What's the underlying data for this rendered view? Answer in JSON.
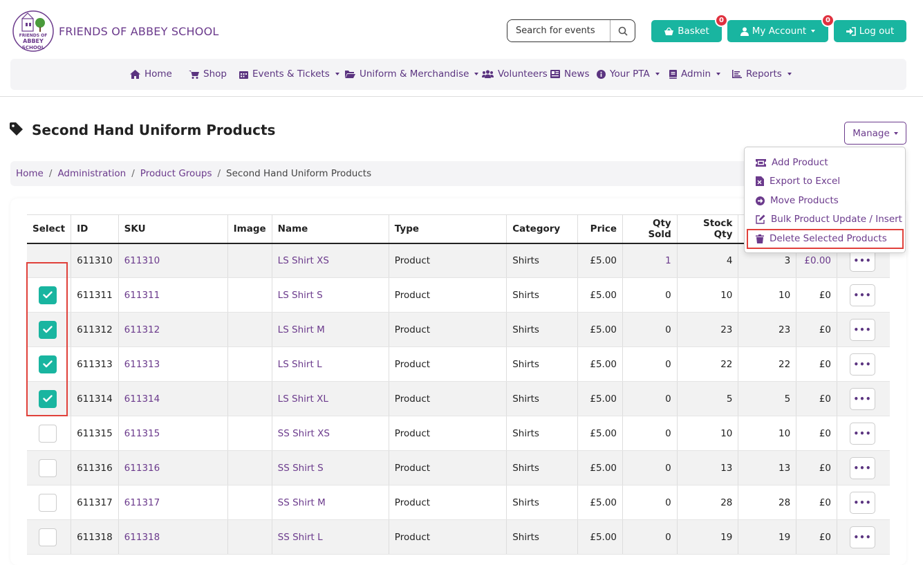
{
  "header": {
    "site_title": "FRIENDS OF ABBEY SCHOOL",
    "logo_text": "FRIENDS OF ABBEY SCHOOL",
    "search_placeholder": "Search for events",
    "basket_label": "Basket",
    "basket_count": "0",
    "account_label": "My Account",
    "account_count": "0",
    "logout_label": "Log out"
  },
  "nav": [
    {
      "label": "Home",
      "icon": "home-icon"
    },
    {
      "label": "Shop",
      "icon": "cart-icon"
    },
    {
      "label": "Events & Tickets",
      "icon": "calendar-icon"
    },
    {
      "label": "Uniform & Merchandise",
      "icon": "folder-icon"
    },
    {
      "label": "Volunteers",
      "icon": "users-icon"
    },
    {
      "label": "News",
      "icon": "newspaper-icon"
    },
    {
      "label": "Your PTA",
      "icon": "info-icon"
    },
    {
      "label": "Admin",
      "icon": "book-icon"
    },
    {
      "label": "Reports",
      "icon": "chart-icon"
    }
  ],
  "page": {
    "title": "Second Hand Uniform Products",
    "manage_label": "Manage"
  },
  "breadcrumb": [
    "Home",
    "Administration",
    "Product Groups",
    "Second Hand Uniform Products"
  ],
  "manage_menu": [
    {
      "label": "Add Product",
      "icon": "ticket-icon"
    },
    {
      "label": "Export to Excel",
      "icon": "excel-icon"
    },
    {
      "label": "Move Products",
      "icon": "arrow-circle-icon"
    },
    {
      "label": "Bulk Product Update / Insert",
      "icon": "edit-icon"
    },
    {
      "label": "Delete Selected Products",
      "icon": "trash-icon"
    }
  ],
  "table": {
    "columns": [
      "Select",
      "ID",
      "SKU",
      "Image",
      "Name",
      "Type",
      "Category",
      "Price",
      "Qty Sold",
      "Stock Qty",
      "",
      "",
      ""
    ],
    "rows": [
      {
        "selected": null,
        "id": "611310",
        "sku": "611310",
        "name": "LS Shirt XS",
        "type": "Product",
        "category": "Shirts",
        "price": "£5.00",
        "qty_sold": "1",
        "stock": "4",
        "avail": "3",
        "revenue": "£0.00"
      },
      {
        "selected": true,
        "id": "611311",
        "sku": "611311",
        "name": "LS Shirt S",
        "type": "Product",
        "category": "Shirts",
        "price": "£5.00",
        "qty_sold": "0",
        "stock": "10",
        "avail": "10",
        "revenue": "£0"
      },
      {
        "selected": true,
        "id": "611312",
        "sku": "611312",
        "name": "LS Shirt M",
        "type": "Product",
        "category": "Shirts",
        "price": "£5.00",
        "qty_sold": "0",
        "stock": "23",
        "avail": "23",
        "revenue": "£0"
      },
      {
        "selected": true,
        "id": "611313",
        "sku": "611313",
        "name": "LS Shirt L",
        "type": "Product",
        "category": "Shirts",
        "price": "£5.00",
        "qty_sold": "0",
        "stock": "22",
        "avail": "22",
        "revenue": "£0"
      },
      {
        "selected": true,
        "id": "611314",
        "sku": "611314",
        "name": "LS Shirt XL",
        "type": "Product",
        "category": "Shirts",
        "price": "£5.00",
        "qty_sold": "0",
        "stock": "5",
        "avail": "5",
        "revenue": "£0"
      },
      {
        "selected": false,
        "id": "611315",
        "sku": "611315",
        "name": "SS Shirt XS",
        "type": "Product",
        "category": "Shirts",
        "price": "£5.00",
        "qty_sold": "0",
        "stock": "10",
        "avail": "10",
        "revenue": "£0"
      },
      {
        "selected": false,
        "id": "611316",
        "sku": "611316",
        "name": "SS Shirt S",
        "type": "Product",
        "category": "Shirts",
        "price": "£5.00",
        "qty_sold": "0",
        "stock": "13",
        "avail": "13",
        "revenue": "£0"
      },
      {
        "selected": false,
        "id": "611317",
        "sku": "611317",
        "name": "SS Shirt M",
        "type": "Product",
        "category": "Shirts",
        "price": "£5.00",
        "qty_sold": "0",
        "stock": "28",
        "avail": "28",
        "revenue": "£0"
      },
      {
        "selected": false,
        "id": "611318",
        "sku": "611318",
        "name": "SS Shirt L",
        "type": "Product",
        "category": "Shirts",
        "price": "£5.00",
        "qty_sold": "0",
        "stock": "19",
        "avail": "19",
        "revenue": "£0"
      }
    ],
    "row_action_label": "•••"
  },
  "colors": {
    "accent": "#19b5a0",
    "brand": "#6b3a8c",
    "highlight": "#e0403a",
    "badge": "#e0313f"
  }
}
